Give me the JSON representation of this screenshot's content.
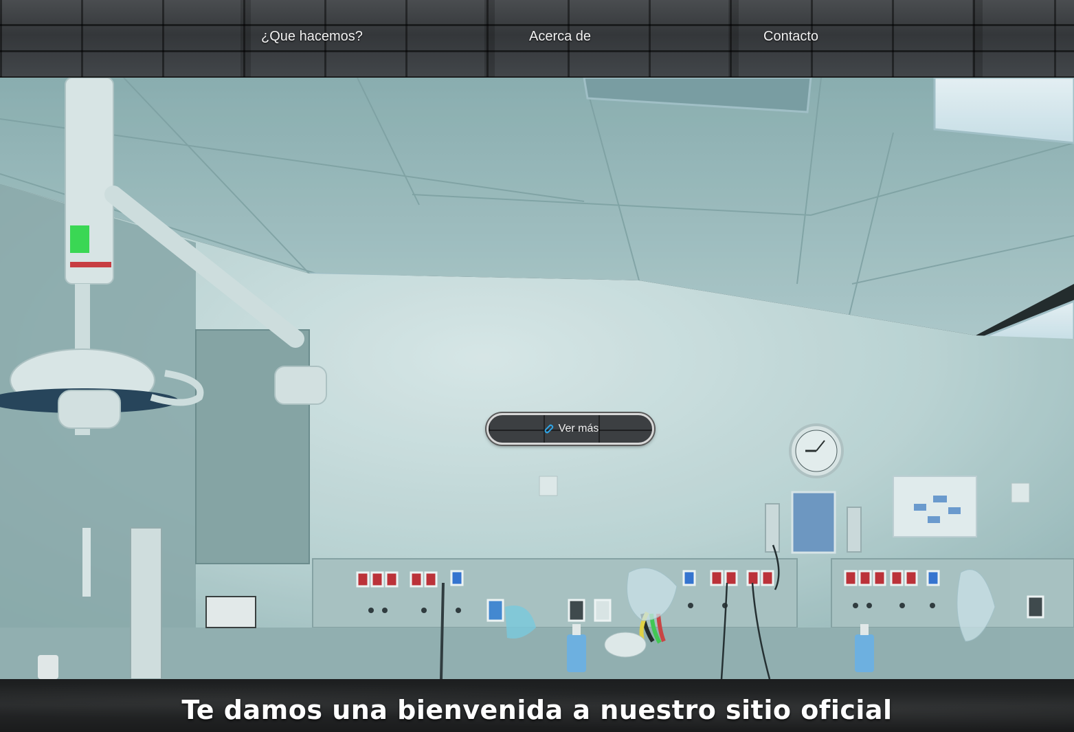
{
  "nav": {
    "items": [
      {
        "label": "¿Que hacemos?"
      },
      {
        "label": "Acerca de"
      },
      {
        "label": "Contacto"
      }
    ]
  },
  "hero": {
    "cta_label": "Ver más",
    "cta_icon": "paperclip-icon"
  },
  "welcome": {
    "title": "Te damos una bienvenida a nuestro sitio oficial"
  },
  "colors": {
    "wall": "#c9dcdc",
    "ceiling": "#a7c2c4",
    "accent_blue": "#1e8fd0",
    "outlet_red": "#c8242c"
  }
}
